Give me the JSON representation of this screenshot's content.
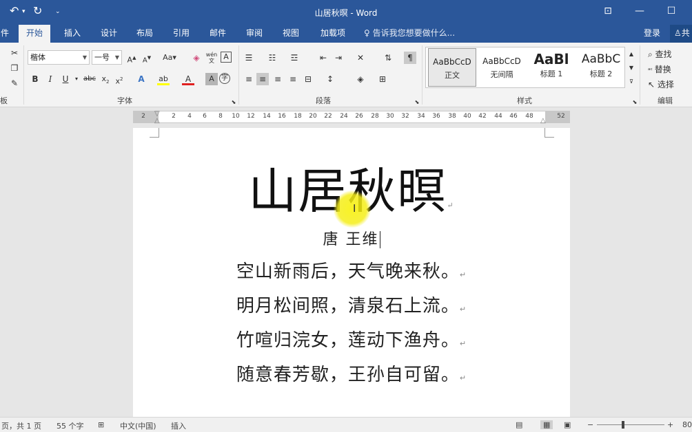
{
  "title_bar": {
    "title": "山居秋暝 - Word",
    "undo_icon": "undo-icon",
    "redo_icon": "redo-icon",
    "customize_icon": "customize-quick-access-icon"
  },
  "tabs": [
    {
      "label": "件"
    },
    {
      "label": "开始",
      "active": true
    },
    {
      "label": "插入"
    },
    {
      "label": "设计"
    },
    {
      "label": "布局"
    },
    {
      "label": "引用"
    },
    {
      "label": "邮件"
    },
    {
      "label": "审阅"
    },
    {
      "label": "视图"
    },
    {
      "label": "加载项"
    }
  ],
  "tell_me": "告诉我您想要做什么...",
  "login": "登录",
  "share": "共",
  "ribbon": {
    "clipboard_label": "板",
    "font": {
      "name": "楷体",
      "size": "一号",
      "label": "字体"
    },
    "paragraph_label": "段落",
    "styles": {
      "label": "样式",
      "items": [
        {
          "sample": "AaBbCcD",
          "name": "正文"
        },
        {
          "sample": "AaBbCcD",
          "name": "无间隔"
        },
        {
          "sample": "AaBl",
          "name": "标题 1"
        },
        {
          "sample": "AaBbC",
          "name": "标题 2"
        }
      ]
    },
    "editing": {
      "find": "查找",
      "replace": "替换",
      "select": "选择",
      "label": "编辑"
    }
  },
  "ruler": {
    "numbers": [
      "2",
      "2",
      "4",
      "6",
      "8",
      "10",
      "12",
      "14",
      "16",
      "18",
      "20",
      "22",
      "24",
      "26",
      "28",
      "30",
      "32",
      "34",
      "36",
      "38",
      "40",
      "42",
      "44",
      "46",
      "48",
      "52"
    ]
  },
  "document": {
    "title": "山居秋暝",
    "author": "唐 王维",
    "lines": [
      "空山新雨后，天气晚来秋。",
      "明月松间照，清泉石上流。",
      "竹喧归浣女，莲动下渔舟。",
      "随意春芳歇，王孙自可留。"
    ],
    "paragraph_mark": "↵"
  },
  "status": {
    "page": "页，共 1 页",
    "words": "55 个字",
    "language": "中文(中国)",
    "mode": "插入",
    "zoom": "80"
  },
  "colors": {
    "accent": "#2b579a",
    "ribbon_bg": "#f3f3f3",
    "highlight": "#f5ee1a"
  }
}
